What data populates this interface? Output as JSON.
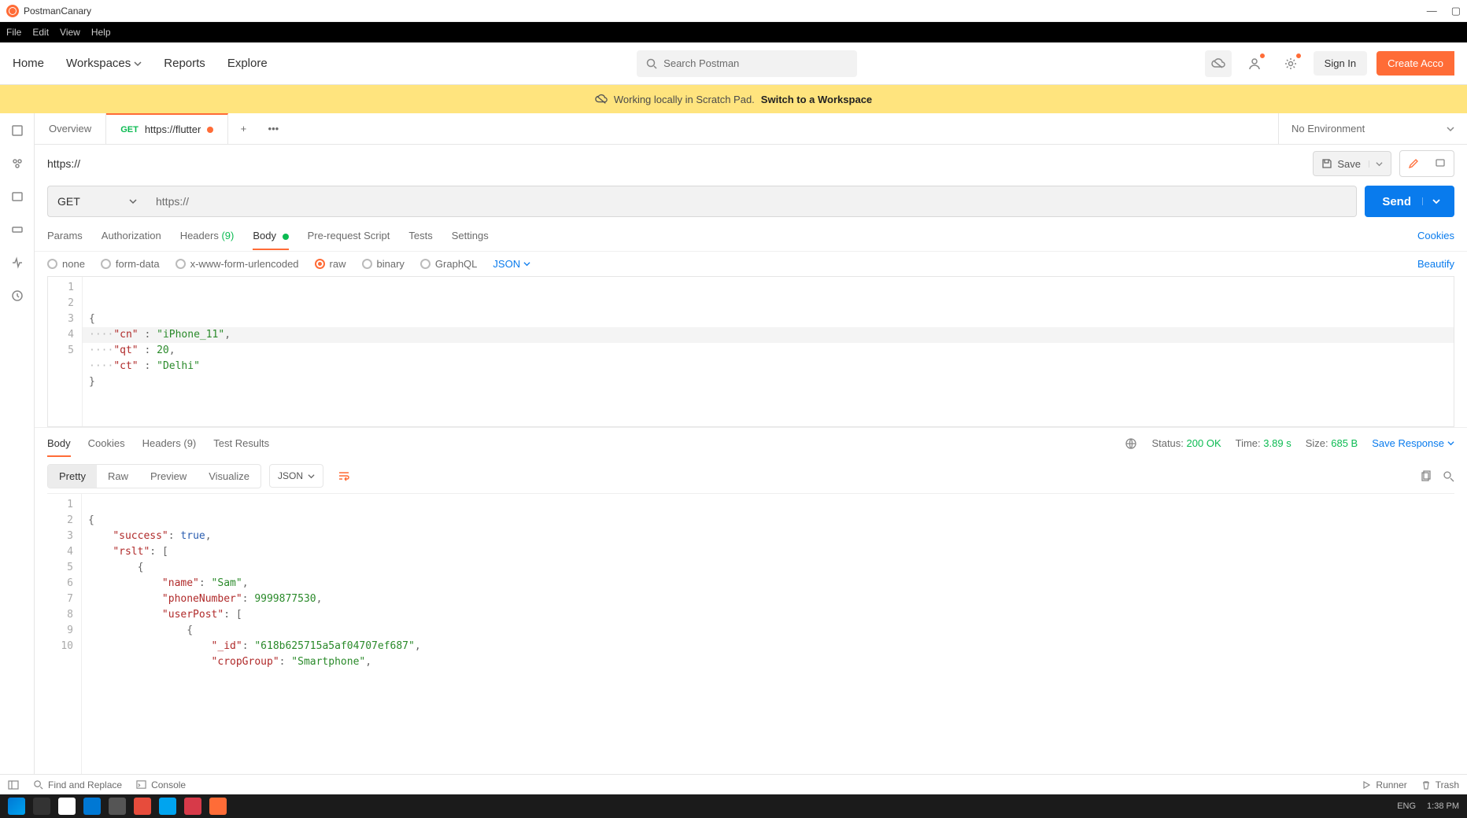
{
  "window": {
    "title": "PostmanCanary"
  },
  "menubar": [
    "File",
    "Edit",
    "View",
    "Help"
  ],
  "topnav": {
    "items": [
      "Home",
      "Workspaces",
      "Reports",
      "Explore"
    ],
    "search_placeholder": "Search Postman",
    "signin": "Sign In",
    "create": "Create Acco"
  },
  "banner": {
    "prefix": "Working locally in Scratch Pad.",
    "action": "Switch to a Workspace"
  },
  "tabs": {
    "overview": "Overview",
    "active": {
      "method": "GET",
      "label": "https://flutter"
    },
    "environment": "No Environment"
  },
  "request": {
    "title": "https://",
    "save": "Save",
    "method": "GET",
    "url": "https://",
    "send": "Send",
    "tabs": {
      "params": "Params",
      "auth": "Authorization",
      "headers": "Headers",
      "headers_count": "(9)",
      "body": "Body",
      "prereq": "Pre-request Script",
      "tests": "Tests",
      "settings": "Settings",
      "cookies": "Cookies"
    },
    "body_types": {
      "none": "none",
      "formdata": "form-data",
      "xwww": "x-www-form-urlencoded",
      "raw": "raw",
      "binary": "binary",
      "graphql": "GraphQL",
      "json": "JSON",
      "beautify": "Beautify"
    },
    "body_editor": {
      "lines": [
        "1",
        "2",
        "3",
        "4",
        "5"
      ],
      "content": {
        "cn": "iPhone_11",
        "qt": 20,
        "ct": "Delhi"
      }
    }
  },
  "response": {
    "tabs": {
      "body": "Body",
      "cookies": "Cookies",
      "headers": "Headers",
      "headers_count": "(9)",
      "tests": "Test Results"
    },
    "status_label": "Status:",
    "status_value": "200 OK",
    "time_label": "Time:",
    "time_value": "3.89 s",
    "size_label": "Size:",
    "size_value": "685 B",
    "save": "Save Response",
    "modes": {
      "pretty": "Pretty",
      "raw": "Raw",
      "preview": "Preview",
      "visualize": "Visualize",
      "json": "JSON"
    },
    "body_editor": {
      "lines": [
        "1",
        "2",
        "3",
        "4",
        "5",
        "6",
        "7",
        "8",
        "9",
        "10"
      ],
      "content": {
        "success": true,
        "rslt": [
          {
            "name": "Sam",
            "phoneNumber": 9999877530,
            "userPost": [
              {
                "_id": "618b625715a5af04707ef687",
                "cropGroup": "Smartphone"
              }
            ]
          }
        ]
      }
    }
  },
  "statusbar": {
    "find": "Find and Replace",
    "console": "Console",
    "runner": "Runner",
    "trash": "Trash"
  },
  "taskbar": {
    "lang": "ENG",
    "time": "1:38 PM"
  }
}
